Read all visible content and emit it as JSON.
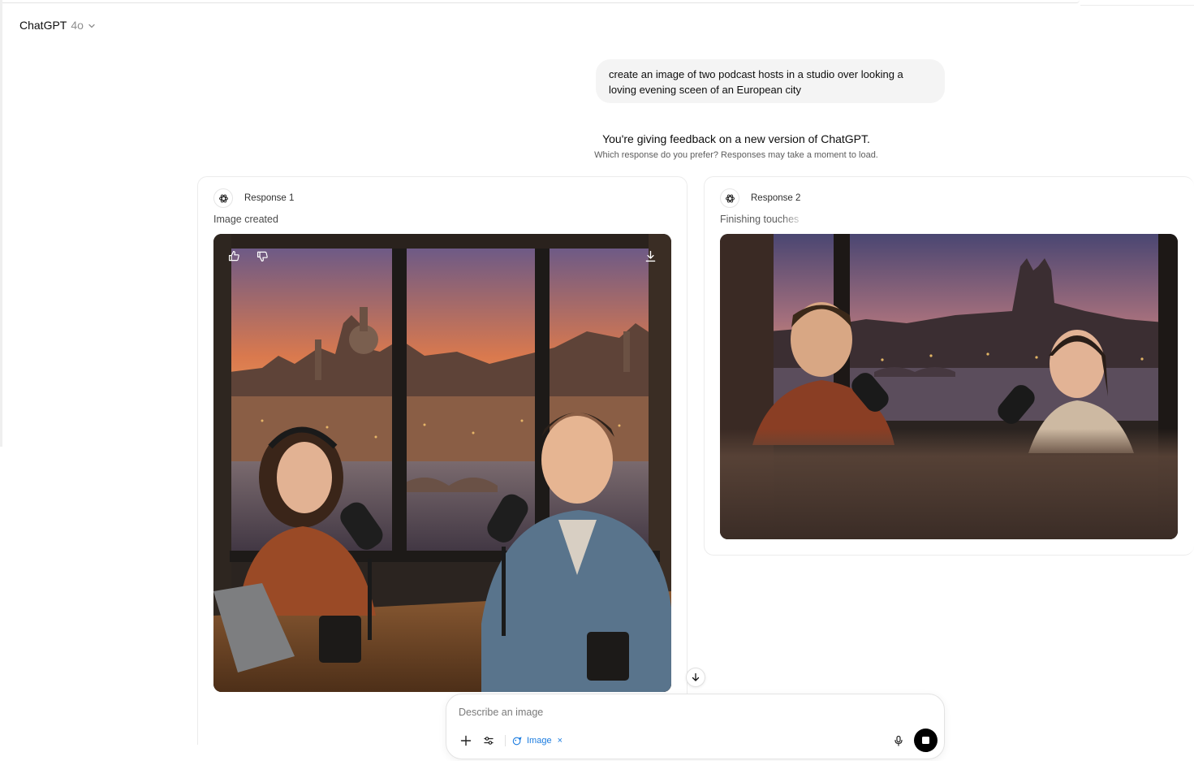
{
  "header": {
    "model_name": "ChatGPT",
    "model_version": "4o"
  },
  "conversation": {
    "user_prompt": "create an image of two podcast hosts in a studio over looking a loving evening sceen of an European city"
  },
  "comparison": {
    "title": "You're giving feedback on a new version of ChatGPT.",
    "subtitle": "Which response do you prefer? Responses may take a moment to load.",
    "responses": [
      {
        "label": "Response 1",
        "status": "Image created"
      },
      {
        "label": "Response 2",
        "status": "Finishing touches"
      }
    ]
  },
  "composer": {
    "placeholder": "Describe an image",
    "tool_chip": "Image",
    "tool_chip_close": "×"
  },
  "colors": {
    "accent": "#1b7ce0",
    "user_bubble": "#f4f4f4",
    "stop_button": "#000000"
  }
}
